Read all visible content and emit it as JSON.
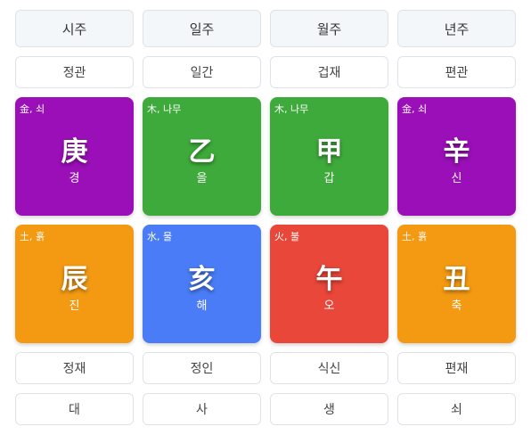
{
  "headers": [
    "시주",
    "일주",
    "월주",
    "년주"
  ],
  "stem_gods": [
    "정관",
    "일간",
    "겁재",
    "편관"
  ],
  "stems": [
    {
      "element": "金, 쇠",
      "hanja": "庚",
      "hangul": "경",
      "color": "#9b0fb8"
    },
    {
      "element": "木, 나무",
      "hanja": "乙",
      "hangul": "을",
      "color": "#3eaa3b"
    },
    {
      "element": "木, 나무",
      "hanja": "甲",
      "hangul": "갑",
      "color": "#3eaa3b"
    },
    {
      "element": "金, 쇠",
      "hanja": "辛",
      "hangul": "신",
      "color": "#9b0fb8"
    }
  ],
  "branches": [
    {
      "element": "土, 흙",
      "hanja": "辰",
      "hangul": "진",
      "color": "#f39a12"
    },
    {
      "element": "水, 물",
      "hanja": "亥",
      "hangul": "해",
      "color": "#4a7cf7"
    },
    {
      "element": "火, 불",
      "hanja": "午",
      "hangul": "오",
      "color": "#e8473a"
    },
    {
      "element": "土, 흙",
      "hanja": "丑",
      "hangul": "축",
      "color": "#f39a12"
    }
  ],
  "branch_gods": [
    "정재",
    "정인",
    "식신",
    "편재"
  ],
  "life_stages": [
    "대",
    "사",
    "생",
    "쇠"
  ]
}
